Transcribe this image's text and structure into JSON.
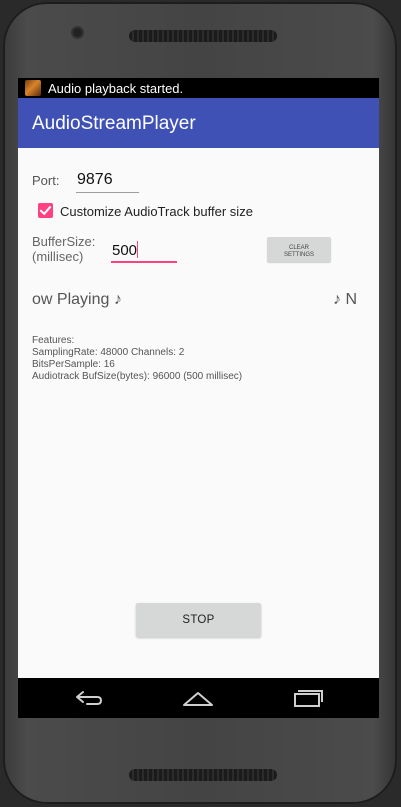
{
  "status_bar": {
    "notification_icon": "album-art-icon",
    "notification_text": "Audio playback started."
  },
  "app_bar": {
    "title": "AudioStreamPlayer",
    "color": "#3f51b5"
  },
  "port": {
    "label": "Port:",
    "value": "9876"
  },
  "buffer_checkbox": {
    "checked": true,
    "label": "Customize AudioTrack buffer size",
    "color": "#ff4081"
  },
  "buffer_size": {
    "label_line1": "BufferSize:",
    "label_line2": "(millisec)",
    "value": "500"
  },
  "clear_button": {
    "line1": "CLEAR",
    "line2": "SETTINGS"
  },
  "now_playing": {
    "left_text": "ow Playing ♪",
    "right_text": "♪ N"
  },
  "features": {
    "line1": "Features:",
    "line2": "SamplingRate: 48000  Channels: 2",
    "line3": "BitsPerSample: 16",
    "line4": "Audiotrack BufSize(bytes): 96000 (500 millisec)"
  },
  "stop_button": {
    "label": "STOP"
  },
  "nav_bar": {
    "back_icon": "back-icon",
    "home_icon": "home-icon",
    "recents_icon": "recents-icon"
  }
}
